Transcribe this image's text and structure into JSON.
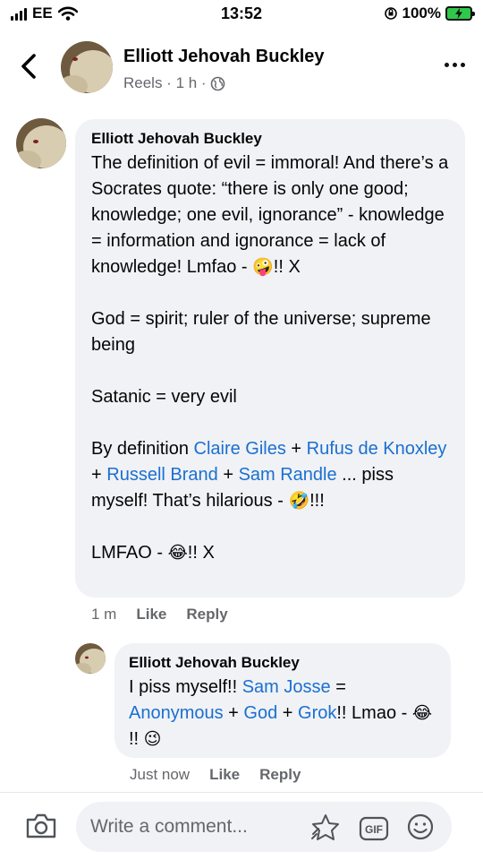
{
  "status": {
    "carrier": "EE",
    "time": "13:52",
    "battery": "100%"
  },
  "header": {
    "name": "Elliott Jehovah Buckley",
    "subtitle": "Reels · 1 h ·"
  },
  "comments": [
    {
      "author": "Elliott Jehovah Buckley",
      "time": "1 m",
      "like": "Like",
      "reply": "Reply"
    },
    {
      "author": "Elliott Jehovah Buckley",
      "time": "Just now",
      "like": "Like",
      "reply": "Reply"
    }
  ],
  "c1": {
    "p1": "The definition of evil = immoral! And there’s a Socrates quote: “there is only one good; knowledge; one evil, ignorance” - knowledge = information and ignorance = lack of knowledge! Lmfao - ",
    "p1_end": "!! X",
    "p2": "God = spirit; ruler of the universe; supreme being",
    "p3": "Satanic = very evil",
    "p4_pre": "By definition ",
    "tag1": "Claire Giles",
    "plus1": " + ",
    "tag2": "Rufus de Knoxley",
    "plus2": " + ",
    "tag3": "Russell Brand",
    "plus3": " + ",
    "tag4": "Sam Randle",
    "p4_post": " ... piss myself! That’s hilarious - ",
    "p4_end": "!!!",
    "p5": "LMFAO - ",
    "p5_end": "!! X"
  },
  "c2": {
    "pre": "I piss myself!! ",
    "tag1": "Sam Josse",
    "eq": " = ",
    "tag2": "Anonymous",
    "plus1": " + ",
    "tag3": "God",
    "plus2": " + ",
    "tag4": "Grok",
    "post": "!! Lmao - ",
    "end": "!! "
  },
  "emojis": {
    "zany": "🤪",
    "rofl": "🤣",
    "joy": "😂",
    "wink": "😉"
  },
  "composer": {
    "placeholder": "Write a comment..."
  },
  "icons": {
    "back": "chevron-left-icon",
    "more": "more-dots-icon",
    "globe": "globe-icon",
    "camera": "camera-icon",
    "sticker": "sticker-icon",
    "gif": "gif-icon",
    "emoji": "smiley-icon"
  },
  "colors": {
    "tag": "#1b6fd1",
    "bubble": "#f0f2f5",
    "secondary": "#65676b"
  }
}
